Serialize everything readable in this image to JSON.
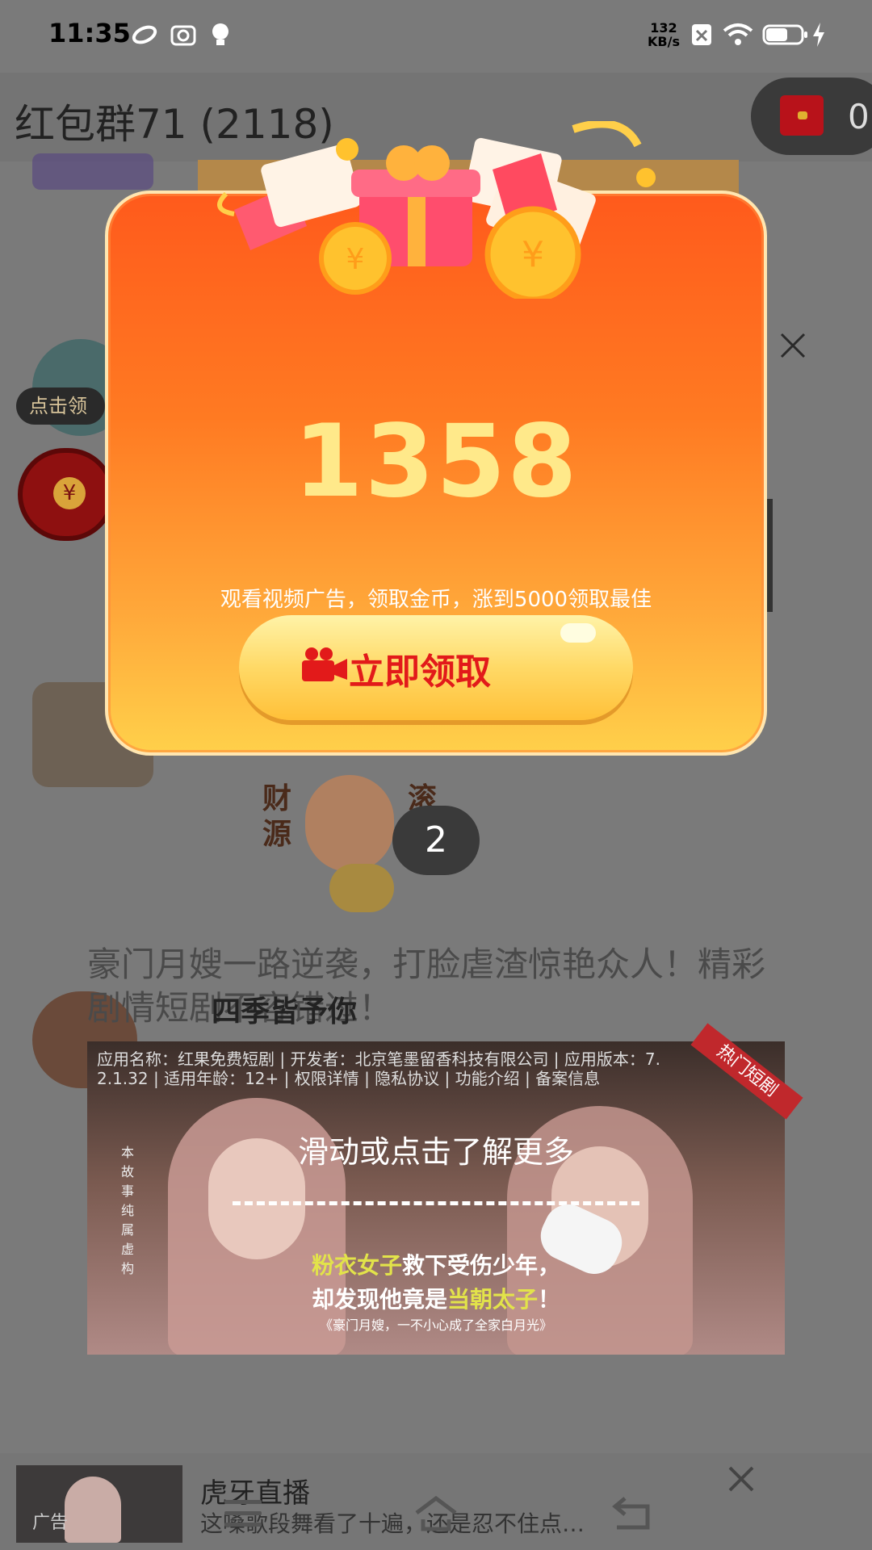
{
  "status_bar": {
    "time": "11:35",
    "net_speed_value": "132",
    "net_speed_unit": "KB/s",
    "icons": [
      "link-icon",
      "camera-icon",
      "bulb-icon",
      "sim-off-icon",
      "wifi-icon",
      "battery-icon",
      "charging-icon"
    ]
  },
  "app_bar": {
    "title": "红包群71 (2118)",
    "redpack_count": "0"
  },
  "background": {
    "click_badge": "点击领",
    "count_bubble": "2",
    "sticker_left": "财\n源",
    "sticker_right": "滚\n滚",
    "headline": "豪门月嫂一路逆袭，打脸虐渣惊艳众人！精彩剧情短剧不容错过！",
    "caption": "四季皆予你"
  },
  "video_ad": {
    "meta_line1": "应用名称：红果免费短剧 | 开发者：北京笔墨留香科技有限公司 | 应用版本：7.",
    "meta_line2": "2.1.32 | 适用年龄：12+ | 权限详情 | 隐私协议 | 功能介绍 | 备案信息",
    "ribbon": "热门短剧",
    "side_text": "本故事纯属虚构",
    "swipe_hint": "滑动或点击了解更多",
    "subtitle1_a": "粉衣女子",
    "subtitle1_b": "救下受伤少年，",
    "subtitle2_a": "却发现他竟是",
    "subtitle2_b": "当朝太子",
    "subtitle2_c": "！",
    "subtitle3": "《豪门月嫂，一不小心成了全家白月光》"
  },
  "popup": {
    "amount": "1358",
    "description": "观看视频广告，领取金币，涨到5000领取最佳",
    "claim_button": "立即领取"
  },
  "bottom_ad": {
    "title": "虎牙直播",
    "desc": "这嗓歌段舞看了十遍，还是忍不住点…",
    "tag": "广告"
  },
  "colors": {
    "popup_top": "#ff5a1c",
    "popup_bottom": "#ffd04a",
    "amount": "#ffe98a",
    "button_text": "#e21a1a"
  }
}
